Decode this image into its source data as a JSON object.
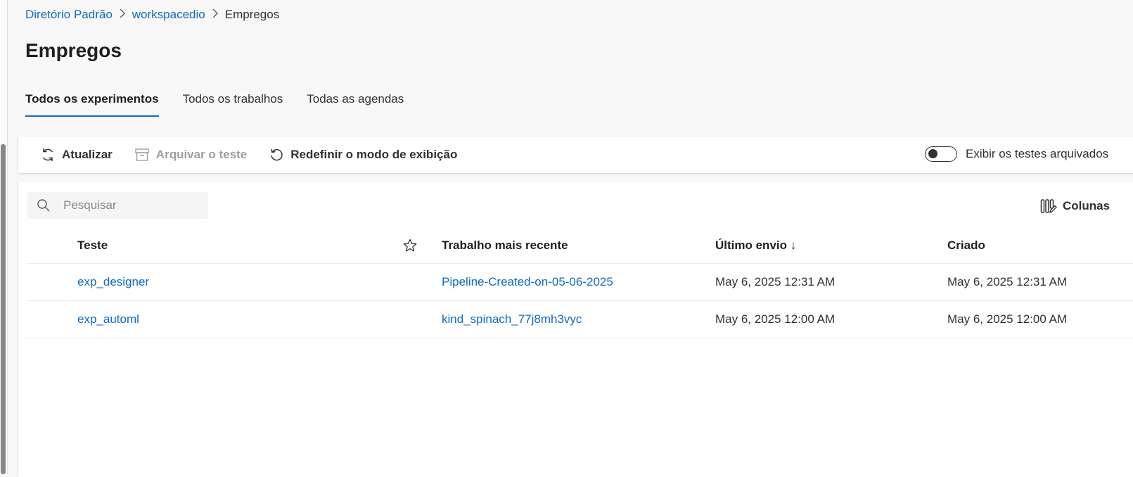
{
  "breadcrumb": {
    "items": [
      "Diretório Padrão",
      "workspacedio"
    ],
    "current": "Empregos"
  },
  "page": {
    "title": "Empregos"
  },
  "tabs": [
    {
      "label": "Todos os experimentos",
      "active": true
    },
    {
      "label": "Todos os trabalhos",
      "active": false
    },
    {
      "label": "Todas as agendas",
      "active": false
    }
  ],
  "toolbar": {
    "refresh_label": "Atualizar",
    "archive_label": "Arquivar o teste",
    "reset_view_label": "Redefinir o modo de exibição",
    "show_archived_label": "Exibir os testes arquivados",
    "show_archived_on": false
  },
  "search": {
    "placeholder": "Pesquisar"
  },
  "columns_button": {
    "label": "Colunas"
  },
  "table": {
    "headers": {
      "name": "Teste",
      "favorite_icon": "star-icon",
      "latest_job": "Trabalho mais recente",
      "last_submitted": "Último envio ↓",
      "created": "Criado"
    },
    "rows": [
      {
        "name": "exp_designer",
        "latest_job": "Pipeline-Created-on-05-06-2025",
        "last_submitted": "May 6, 2025 12:31 AM",
        "created": "May 6, 2025 12:31 AM"
      },
      {
        "name": "exp_automl",
        "latest_job": "kind_spinach_77j8mh3vyc",
        "last_submitted": "May 6, 2025 12:00 AM",
        "created": "May 6, 2025 12:00 AM"
      }
    ]
  },
  "colors": {
    "accent": "#0f6cbd",
    "text": "#201f1e",
    "disabled": "#a19f9d"
  }
}
